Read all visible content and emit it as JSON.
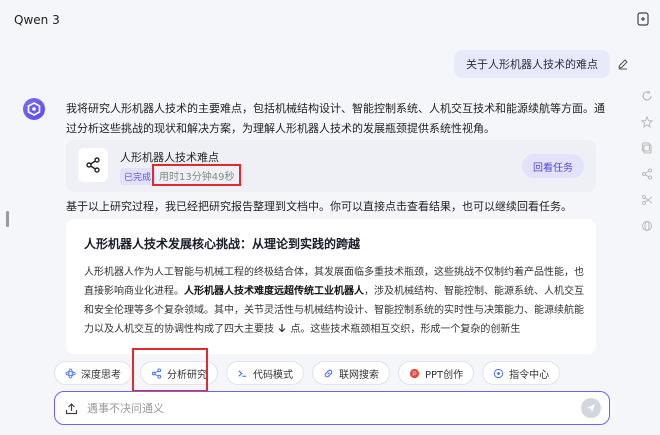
{
  "header": {
    "app_title": "Qwen 3"
  },
  "user_message": {
    "text": "关于人形机器人技术的难点"
  },
  "assistant": {
    "intro": "我将研究人形机器人技术的主要难点，包括机械结构设计、智能控制系统、人机交互技术和能源续航等方面。通过分析这些挑战的现状和解决方案，为理解人形机器人技术的发展瓶颈提供系统性视角。",
    "task": {
      "title": "人形机器人技术难点",
      "status": "已完成",
      "elapsed": "用时13分钟49秒",
      "review_label": "回看任务"
    },
    "followup": "基于以上研究过程，我已经把研究报告整理到文档中。你可以直接点击查看结果，也可以继续回看任务。",
    "doc": {
      "title": "人形机器人技术发展核心挑战：从理论到实践的跨越",
      "p1": "人形机器人作为人工智能与机械工程的终极结合体，其发展面临多重技术瓶颈，这些挑战不仅制约着产品性能，也直接影响商业化进程。",
      "p1_bold": "人形机器人技术难度远超传统工业机器人",
      "p1_rest": "，涉及机械结构、智能控制、能源系统、人机交互和安全伦理等多个复杂领域。其中，关节灵活性与机械结构设计、智能控制系统的实时性与决策能力、能源续航能力以及人机交互的协调性构成了四大主要技",
      "p1_tail": "点。这些技术瓶颈相互交织，形成一个复杂的创新生"
    }
  },
  "toolbar": {
    "chips": [
      "深度思考",
      "分析研究",
      "代码模式",
      "联网搜索",
      "PPT创作",
      "指令中心"
    ]
  },
  "composer": {
    "placeholder": "遇事不决问通义"
  }
}
